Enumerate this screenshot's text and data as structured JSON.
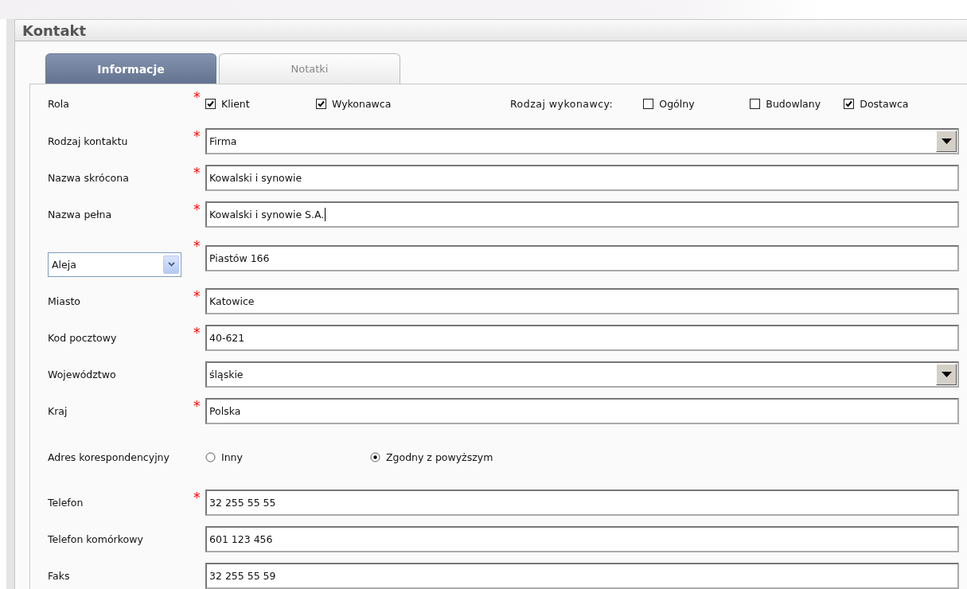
{
  "panel": {
    "title": "Kontakt"
  },
  "tabs": [
    {
      "label": "Informacje",
      "selected": true
    },
    {
      "label": "Notatki",
      "selected": false
    }
  ],
  "required_mark": "*",
  "rows": [
    {
      "kind": "checkboxes",
      "label": "Rola",
      "required": true,
      "options": [
        {
          "label": "Klient",
          "checked": true
        },
        {
          "label": "Wykonawca",
          "checked": true
        }
      ],
      "group": {
        "label": "Rodzaj wykonawcy:",
        "options": [
          {
            "label": "Ogólny",
            "checked": false
          },
          {
            "label": "Budowlany",
            "checked": false
          },
          {
            "label": "Dostawca",
            "checked": true
          }
        ]
      }
    },
    {
      "kind": "select",
      "label": "Rodzaj kontaktu",
      "required": true,
      "value": "Firma"
    },
    {
      "kind": "text",
      "label": "Nazwa skrócona",
      "required": true,
      "value": "Kowalski i synowie"
    },
    {
      "kind": "text",
      "label": "Nazwa pełna",
      "required": true,
      "value": "Kowalski i synowie S.A.",
      "focused": true
    },
    {
      "kind": "street",
      "prefix": "Aleja",
      "required": true,
      "value": "Piastów 166"
    },
    {
      "kind": "text",
      "label": "Miasto",
      "required": true,
      "value": "Katowice"
    },
    {
      "kind": "text",
      "label": "Kod pocztowy",
      "required": true,
      "value": "40-621"
    },
    {
      "kind": "select",
      "label": "Województwo",
      "required": false,
      "value": "śląskie"
    },
    {
      "kind": "text",
      "label": "Kraj",
      "required": true,
      "value": "Polska"
    },
    {
      "kind": "radios",
      "label": "Adres korespondencyjny",
      "required": false,
      "options": [
        {
          "label": "Inny",
          "selected": false
        },
        {
          "label": "Zgodny z powyższym",
          "selected": true
        }
      ]
    },
    {
      "kind": "text",
      "label": "Telefon",
      "required": true,
      "value": "32 255 55 55"
    },
    {
      "kind": "text",
      "label": "Telefon komórkowy",
      "required": false,
      "value": "601 123 456"
    },
    {
      "kind": "text",
      "label": "Faks",
      "required": false,
      "value": "32 255 55 59"
    }
  ]
}
